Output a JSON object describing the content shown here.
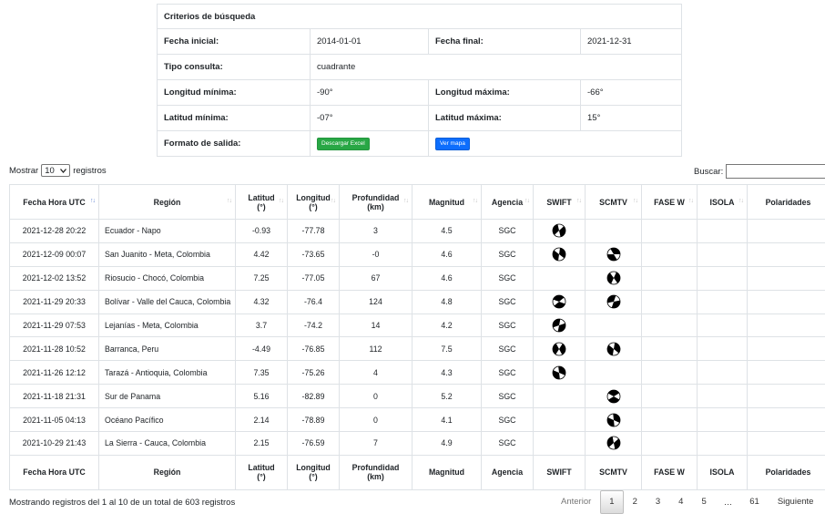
{
  "criteria": {
    "header": "Criterios de búsqueda",
    "fecha_inicial_label": "Fecha inicial:",
    "fecha_inicial": "2014-01-01",
    "fecha_final_label": "Fecha final:",
    "fecha_final": "2021-12-31",
    "tipo_label": "Tipo consulta:",
    "tipo": "cuadrante",
    "lon_min_label": "Longitud mínima:",
    "lon_min": "-90°",
    "lon_max_label": "Longitud máxima:",
    "lon_max": "-66°",
    "lat_min_label": "Latitud mínima:",
    "lat_min": "-07°",
    "lat_max_label": "Latitud máxima:",
    "lat_max": "15°",
    "formato_label": "Formato de salida:",
    "excel_button": "Descargar Excel",
    "map_button": "Ver mapa"
  },
  "length": {
    "prefix": "Mostrar",
    "value": "10",
    "suffix": "registros"
  },
  "search": {
    "label": "Buscar:",
    "value": ""
  },
  "columns": {
    "fecha": "Fecha Hora UTC",
    "region": "Región",
    "lat_1": "Latitud",
    "lat_2": "(°)",
    "lon_1": "Longitud",
    "lon_2": "(°)",
    "prof_1": "Profundidad",
    "prof_2": "(km)",
    "mag": "Magnitud",
    "agencia": "Agencia",
    "swift": "SWIFT",
    "scmtv": "SCMTV",
    "fasew": "FASE W",
    "isola": "ISOLA",
    "polaridades": "Polaridades"
  },
  "rows": [
    {
      "fecha": "2021-12-28 20:22",
      "region": "Ecuador - Napo",
      "lat": "-0.93",
      "lon": "-77.78",
      "prof": "3",
      "mag": "4.5",
      "agencia": "SGC",
      "swift": true,
      "scmtv": false
    },
    {
      "fecha": "2021-12-09 00:07",
      "region": "San Juanito - Meta, Colombia",
      "lat": "4.42",
      "lon": "-73.65",
      "prof": "-0",
      "mag": "4.6",
      "agencia": "SGC",
      "swift": true,
      "scmtv": true
    },
    {
      "fecha": "2021-12-02 13:52",
      "region": "Riosucio - Chocó, Colombia",
      "lat": "7.25",
      "lon": "-77.05",
      "prof": "67",
      "mag": "4.6",
      "agencia": "SGC",
      "swift": false,
      "scmtv": true
    },
    {
      "fecha": "2021-11-29 20:33",
      "region": "Bolívar - Valle del Cauca, Colombia",
      "lat": "4.32",
      "lon": "-76.4",
      "prof": "124",
      "mag": "4.8",
      "agencia": "SGC",
      "swift": true,
      "scmtv": true
    },
    {
      "fecha": "2021-11-29 07:53",
      "region": "Lejanías - Meta, Colombia",
      "lat": "3.7",
      "lon": "-74.2",
      "prof": "14",
      "mag": "4.2",
      "agencia": "SGC",
      "swift": true,
      "scmtv": false
    },
    {
      "fecha": "2021-11-28 10:52",
      "region": "Barranca, Peru",
      "lat": "-4.49",
      "lon": "-76.85",
      "prof": "112",
      "mag": "7.5",
      "agencia": "SGC",
      "swift": true,
      "scmtv": true
    },
    {
      "fecha": "2021-11-26 12:12",
      "region": "Tarazá - Antioquia, Colombia",
      "lat": "7.35",
      "lon": "-75.26",
      "prof": "4",
      "mag": "4.3",
      "agencia": "SGC",
      "swift": true,
      "scmtv": false
    },
    {
      "fecha": "2021-11-18 21:31",
      "region": "Sur de Panama",
      "lat": "5.16",
      "lon": "-82.89",
      "prof": "0",
      "mag": "5.2",
      "agencia": "SGC",
      "swift": false,
      "scmtv": true
    },
    {
      "fecha": "2021-11-05 04:13",
      "region": "Océano Pacífico",
      "lat": "2.14",
      "lon": "-78.89",
      "prof": "0",
      "mag": "4.1",
      "agencia": "SGC",
      "swift": false,
      "scmtv": true
    },
    {
      "fecha": "2021-10-29 21:43",
      "region": "La Sierra - Cauca, Colombia",
      "lat": "2.15",
      "lon": "-76.59",
      "prof": "7",
      "mag": "4.9",
      "agencia": "SGC",
      "swift": false,
      "scmtv": true
    }
  ],
  "info": "Mostrando registros del 1 al 10 de un total de 603 registros",
  "pagination": {
    "previous": "Anterior",
    "pages": [
      "1",
      "2",
      "3",
      "4",
      "5"
    ],
    "ellipsis": "…",
    "last": "61",
    "next": "Siguiente",
    "current": "1"
  }
}
